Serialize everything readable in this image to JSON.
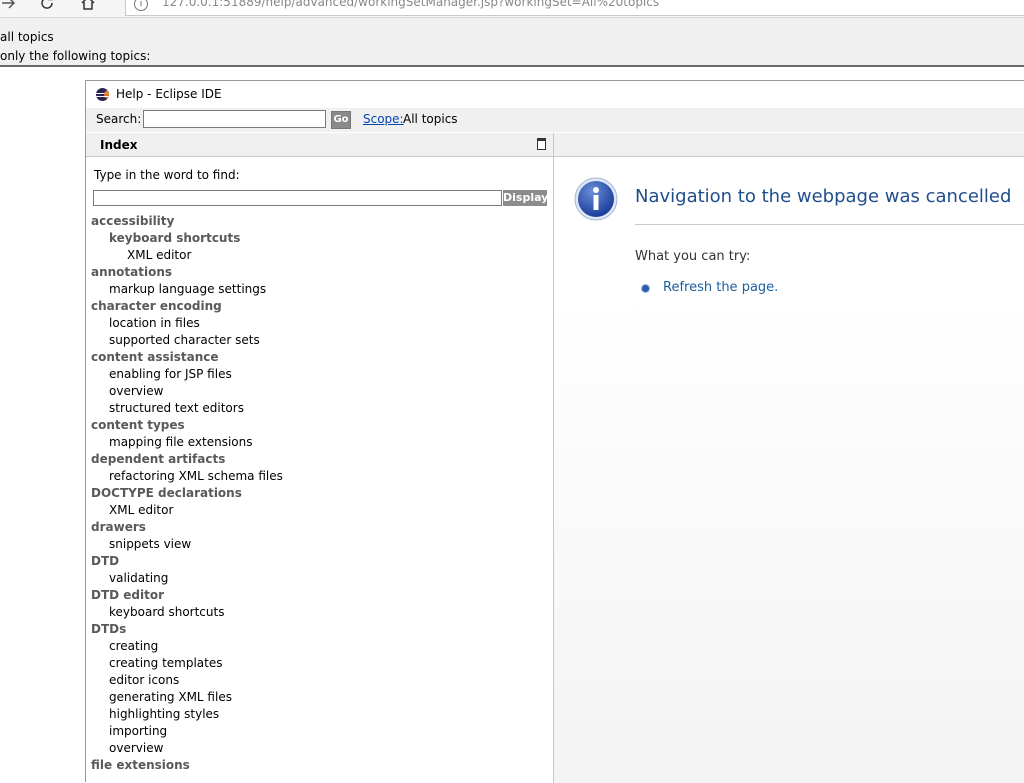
{
  "browser": {
    "url_host": "127.0.0.1",
    "url_rest": ":51889/help/advanced/workingSetManager.jsp?workingSet=All%20topics"
  },
  "working_set_options": {
    "all_topics": "all topics",
    "only_following": "only the following topics:"
  },
  "window": {
    "title": "Help - Eclipse IDE"
  },
  "search": {
    "label": "Search:",
    "value": "",
    "go_label": "Go",
    "scope_link": "Scope:",
    "scope_value": "All topics"
  },
  "index": {
    "title": "Index",
    "find_label": "Type in the word to find:",
    "find_value": "",
    "display_label": "Display",
    "entries": [
      {
        "text": "accessibility",
        "level": 0
      },
      {
        "text": "keyboard shortcuts",
        "level": 1,
        "bold": true
      },
      {
        "text": "XML editor",
        "level": 2
      },
      {
        "text": "annotations",
        "level": 0
      },
      {
        "text": "markup language settings",
        "level": 1
      },
      {
        "text": "character encoding",
        "level": 0
      },
      {
        "text": "location in files",
        "level": 1
      },
      {
        "text": "supported character sets",
        "level": 1
      },
      {
        "text": "content assistance",
        "level": 0
      },
      {
        "text": "enabling for JSP files",
        "level": 1
      },
      {
        "text": "overview",
        "level": 1
      },
      {
        "text": "structured text editors",
        "level": 1
      },
      {
        "text": "content types",
        "level": 0
      },
      {
        "text": "mapping file extensions",
        "level": 1
      },
      {
        "text": "dependent artifacts",
        "level": 0
      },
      {
        "text": "refactoring XML schema files",
        "level": 1
      },
      {
        "text": "DOCTYPE declarations",
        "level": 0
      },
      {
        "text": "XML editor",
        "level": 1
      },
      {
        "text": "drawers",
        "level": 0
      },
      {
        "text": "snippets view",
        "level": 1
      },
      {
        "text": "DTD",
        "level": 0
      },
      {
        "text": "validating",
        "level": 1
      },
      {
        "text": "DTD editor",
        "level": 0
      },
      {
        "text": "keyboard shortcuts",
        "level": 1
      },
      {
        "text": "DTDs",
        "level": 0
      },
      {
        "text": "creating",
        "level": 1
      },
      {
        "text": "creating templates",
        "level": 1
      },
      {
        "text": "editor icons",
        "level": 1
      },
      {
        "text": "generating XML files",
        "level": 1
      },
      {
        "text": "highlighting styles",
        "level": 1
      },
      {
        "text": "importing",
        "level": 1
      },
      {
        "text": "overview",
        "level": 1
      },
      {
        "text": "file extensions",
        "level": 0
      }
    ]
  },
  "content": {
    "error_title": "Navigation to the webpage was cancelled",
    "try_label": "What you can try:",
    "refresh_link": "Refresh the page.",
    "info_icon": "info-icon",
    "accent_color": "#1f4e8c"
  }
}
